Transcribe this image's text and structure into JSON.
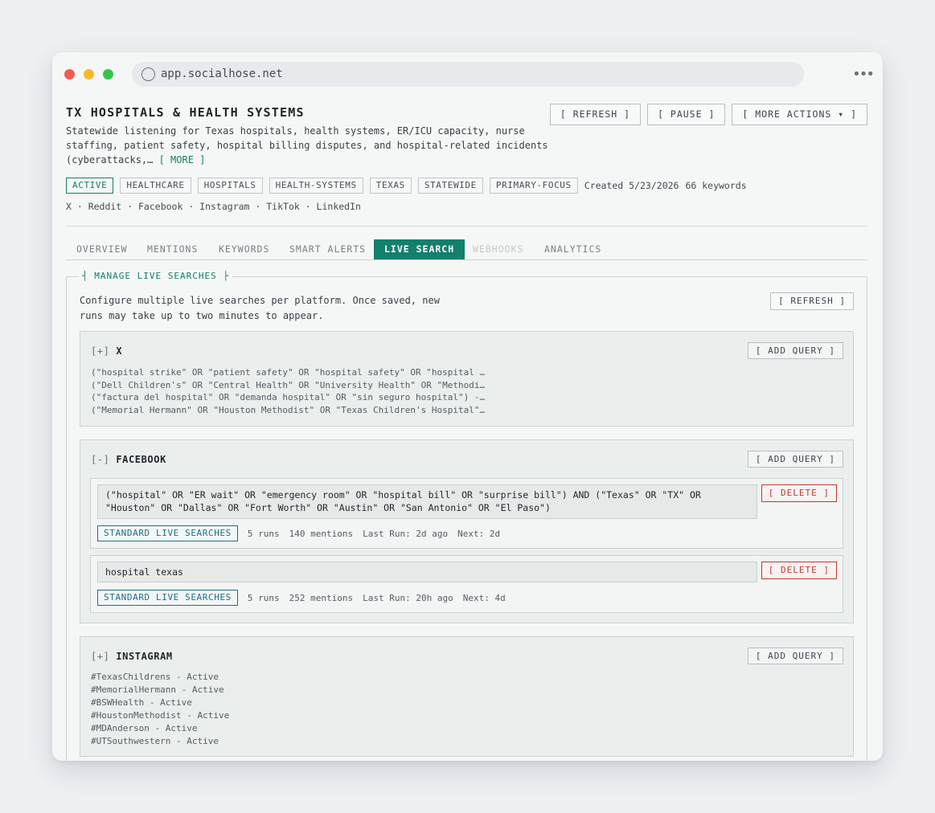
{
  "browser": {
    "url": "app.socialhose.net",
    "menu_glyph": "•••"
  },
  "header": {
    "title": "TX HOSPITALS & HEALTH SYSTEMS",
    "description": "Statewide listening for Texas hospitals, health systems, ER/ICU capacity, nurse staffing, patient safety, hospital billing disputes, and hospital-related incidents (cyberattacks,…",
    "more_label": "[ MORE ]",
    "actions": {
      "refresh": "[ REFRESH ]",
      "pause": "[ PAUSE ]",
      "more_actions": "[ MORE ACTIONS ▾ ]"
    },
    "tags": [
      "ACTIVE",
      "HEALTHCARE",
      "HOSPITALS",
      "HEALTH-SYSTEMS",
      "TEXAS",
      "STATEWIDE",
      "PRIMARY-FOCUS"
    ],
    "created": "Created 5/23/2026",
    "keywords": "66 keywords",
    "platforms": "X · Reddit · Facebook · Instagram · TikTok · LinkedIn"
  },
  "tabs": [
    {
      "label": "OVERVIEW"
    },
    {
      "label": "MENTIONS"
    },
    {
      "label": "KEYWORDS"
    },
    {
      "label": "SMART ALERTS"
    },
    {
      "label": "LIVE SEARCH"
    },
    {
      "label": "WEBHOOKS"
    },
    {
      "label": "ANALYTICS"
    }
  ],
  "live_search": {
    "legend": "┤ MANAGE LIVE SEARCHES ├",
    "intro": "Configure multiple live searches per platform. Once saved, new runs may take up to two minutes to appear.",
    "refresh": "[ REFRESH ]",
    "sections": {
      "x": {
        "toggle": "[+]",
        "name": "X",
        "add": "[ ADD QUERY ]",
        "queries": [
          "(\"hospital strike\" OR \"patient safety\" OR \"hospital safety\" OR \"hospital …",
          "(\"Dell Children's\" OR \"Central Health\" OR \"University Health\" OR \"Methodi…",
          "(\"factura del hospital\" OR \"demanda hospital\" OR \"sin seguro hospital\") -…",
          "(\"Memorial Hermann\" OR \"Houston Methodist\" OR \"Texas Children's Hospital\"…"
        ]
      },
      "facebook": {
        "toggle": "[-]",
        "name": "FACEBOOK",
        "add": "[ ADD QUERY ]",
        "queries": [
          {
            "text": "(\"hospital\" OR \"ER wait\" OR \"emergency room\" OR \"hospital bill\" OR \"surprise bill\") AND (\"Texas\" OR \"TX\" OR\n\"Houston\" OR \"Dallas\" OR \"Fort Worth\" OR \"Austin\" OR \"San Antonio\" OR \"El Paso\")",
            "delete": "[ DELETE ]",
            "badge": "STANDARD LIVE SEARCHES",
            "runs": "5 runs",
            "mentions": "140 mentions",
            "last_run": "Last Run: 2d ago",
            "next": "Next: 2d"
          },
          {
            "text": "hospital texas",
            "delete": "[ DELETE ]",
            "badge": "STANDARD LIVE SEARCHES",
            "runs": "5 runs",
            "mentions": "252 mentions",
            "last_run": "Last Run: 20h ago",
            "next": "Next: 4d"
          }
        ]
      },
      "instagram": {
        "toggle": "[+]",
        "name": "INSTAGRAM",
        "add": "[ ADD QUERY ]",
        "queries": [
          "#TexasChildrens - Active",
          "#MemorialHermann - Active",
          "#BSWHealth - Active",
          "#HoustonMethodist - Active",
          "#MDAnderson - Active",
          "#UTSouthwestern - Active"
        ]
      }
    }
  }
}
